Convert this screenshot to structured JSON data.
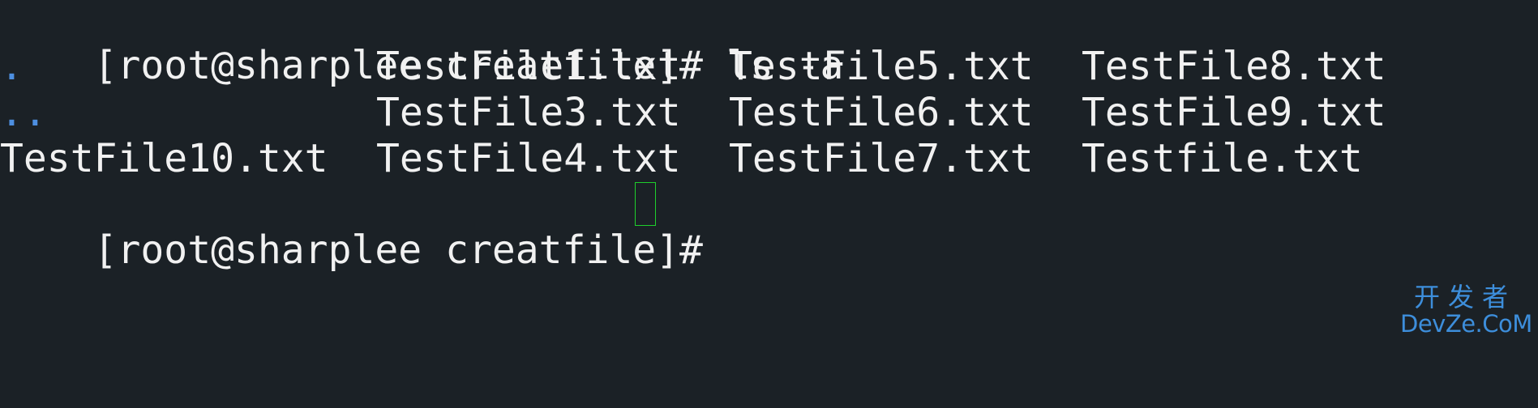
{
  "terminal": {
    "lines": [
      {
        "prompt": "[root@sharplee creatfile]# ",
        "command": "ls -a"
      }
    ],
    "listing": {
      "row1": [
        ".",
        "TestFile1.txt",
        "TestFile5.txt",
        "TestFile8.txt"
      ],
      "row2": [
        "..",
        "TestFile3.txt",
        "TestFile6.txt",
        "TestFile9.txt"
      ],
      "row3": [
        "TestFile10.txt",
        "TestFile4.txt",
        "TestFile7.txt",
        "Testfile.txt"
      ]
    },
    "final_prompt": "[root@sharplee creatfile]# ",
    "colors": {
      "background": "#1b2126",
      "text": "#f1f1f1",
      "directory": "#4d8fe0",
      "cursor": "#1fcf2c"
    }
  },
  "watermark": {
    "cn": "开发者",
    "en": "DevZe.CoM"
  }
}
